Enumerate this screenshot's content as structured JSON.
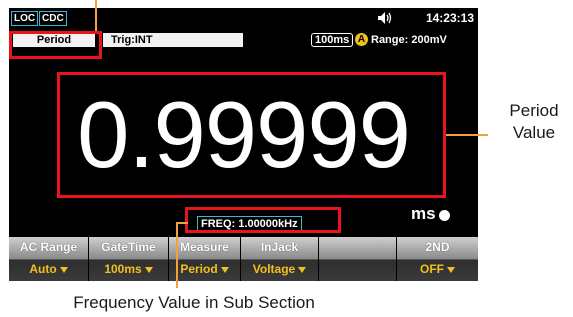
{
  "status_bar": {
    "loc": "LOC",
    "cdc": "CDC",
    "speaker_icon": "speaker-icon",
    "time": "14:23:13"
  },
  "info_bar": {
    "function": "Period",
    "trigger": "Trig:INT",
    "rate": "100ms",
    "auto_badge": "A",
    "range": "Range: 200mV"
  },
  "display": {
    "main_value": "0.99999",
    "unit": "ms",
    "sub_value": "FREQ: 1.00000kHz"
  },
  "softkeys": [
    {
      "title": "AC Range",
      "value": "Auto",
      "arrow": true
    },
    {
      "title": "GateTime",
      "value": "100ms",
      "arrow": true
    },
    {
      "title": "Measure",
      "value": "Period",
      "arrow": true
    },
    {
      "title": "InJack",
      "value": "Voltage",
      "arrow": true
    },
    {
      "title": "",
      "value": "",
      "arrow": false
    },
    {
      "title": "2ND",
      "value": "OFF",
      "arrow": true
    }
  ],
  "callouts": {
    "period_value": [
      "Period",
      "Value"
    ],
    "frequency_value": "Frequency Value in Sub Section"
  },
  "colors": {
    "screen_background": "#000000",
    "annotation_red": "#e8141c",
    "callout_orange": "#f0a040",
    "softkey_value_yellow": "#f0c020",
    "tag_cyan": "#3fb6d8"
  }
}
